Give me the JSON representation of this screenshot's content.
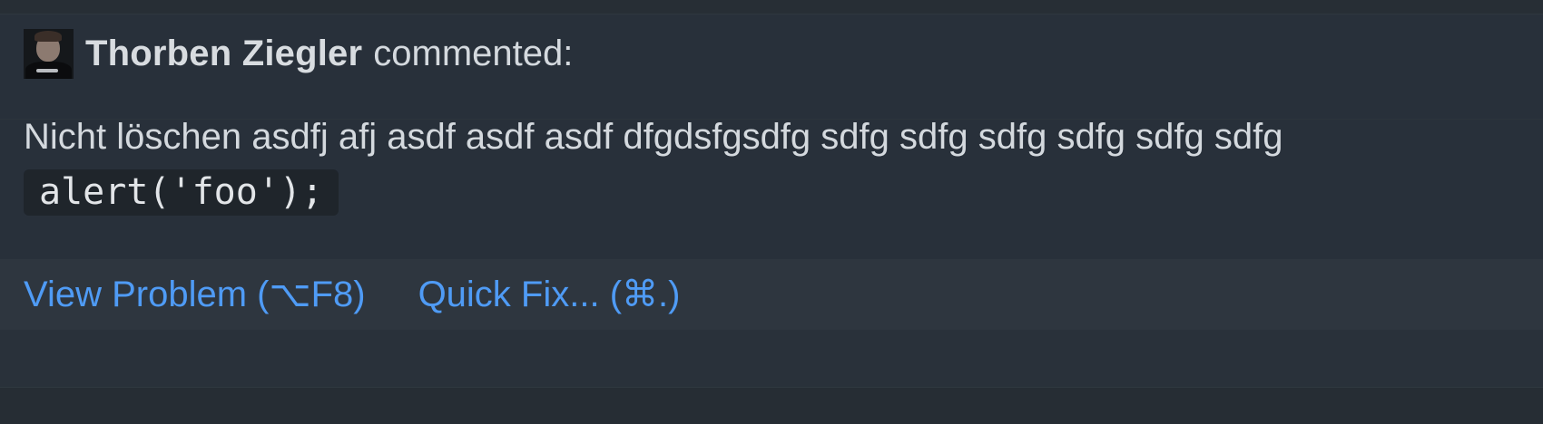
{
  "comment": {
    "author": "Thorben Ziegler",
    "verb": "commented:",
    "body": "Nicht löschen asdfj afj asdf asdf asdf dfgdsfgsdfg sdfg sdfg sdfg sdfg sdfg sdfg",
    "code": "alert('foo');"
  },
  "actions": {
    "view_problem": "View Problem (⌥F8)",
    "quick_fix": "Quick Fix... (⌘.)"
  },
  "colors": {
    "background": "#282f36",
    "link": "#4f9bf5",
    "code_background": "#1f252b"
  }
}
